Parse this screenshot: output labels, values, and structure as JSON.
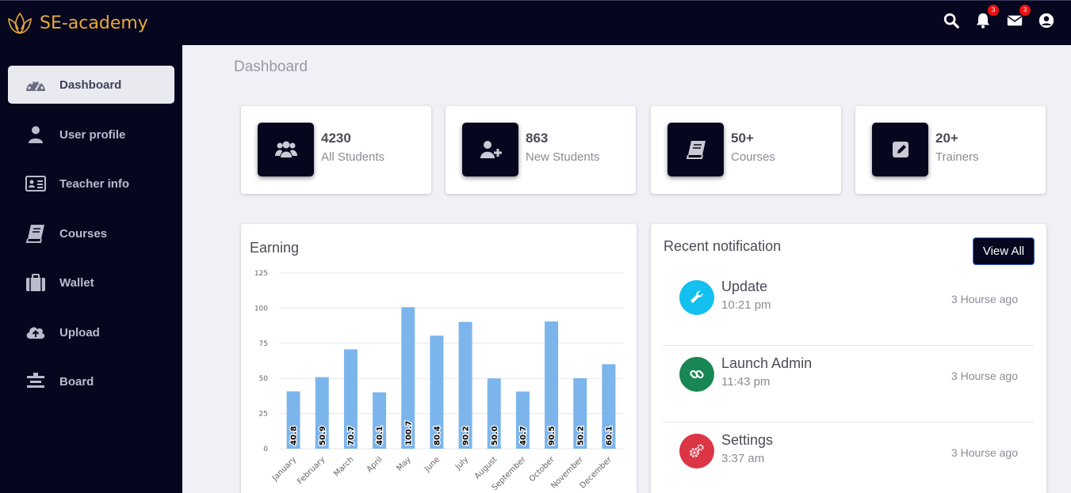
{
  "app": {
    "brand_name": "SE-academy",
    "brand_color": "#e6a93a",
    "notifications_badge": "3",
    "messages_badge": "3"
  },
  "sidebar": {
    "items": [
      {
        "label": "Dashboard",
        "icon": "dashboard-gauge-icon",
        "active": true
      },
      {
        "label": "User profile",
        "icon": "user-icon"
      },
      {
        "label": "Teacher info",
        "icon": "id-card-icon"
      },
      {
        "label": "Courses",
        "icon": "book-icon"
      },
      {
        "label": "Wallet",
        "icon": "briefcase-icon"
      },
      {
        "label": "Upload",
        "icon": "cloud-upload-icon"
      },
      {
        "label": "Board",
        "icon": "board-icon"
      }
    ]
  },
  "main": {
    "page_title": "Dashboard",
    "stats": [
      {
        "value": "4230",
        "label": "All Students",
        "icon": "users-icon"
      },
      {
        "value": "863",
        "label": "New Students",
        "icon": "user-plus-icon"
      },
      {
        "value": "50+",
        "label": "Courses",
        "icon": "book-icon"
      },
      {
        "value": "20+",
        "label": "Trainers",
        "icon": "edit-icon"
      }
    ],
    "earning": {
      "title": "Earning"
    },
    "notifications": {
      "title": "Recent notification",
      "view_all_label": "View All",
      "items": [
        {
          "title": "Update",
          "time": "10:21 pm",
          "ago": "3 Hourse ago",
          "icon": "wrench-icon",
          "color": "#13c0f0"
        },
        {
          "title": "Launch Admin",
          "time": "11:43 pm",
          "ago": "3 Hourse ago",
          "icon": "link-icon",
          "color": "#198754"
        },
        {
          "title": "Settings",
          "time": "3:37 am",
          "ago": "3 Hourse ago",
          "icon": "cogs-icon",
          "color": "#dc3545"
        }
      ]
    }
  },
  "chart_data": {
    "type": "bar",
    "title": "Earning",
    "categories": [
      "January",
      "February",
      "March",
      "April",
      "May",
      "June",
      "July",
      "August",
      "September",
      "October",
      "November",
      "December"
    ],
    "values": [
      40.8,
      50.9,
      70.7,
      40.1,
      100.7,
      80.4,
      90.2,
      50.0,
      40.7,
      90.5,
      50.2,
      60.1
    ],
    "value_labels": [
      "40.8",
      "50.9",
      "70.7",
      "40.1",
      "100.7",
      "80.4",
      "90.2",
      "50.0",
      "40.7",
      "90.5",
      "50.2",
      "60.1"
    ],
    "ylim": [
      0,
      125
    ],
    "yticks": [
      "0",
      "25",
      "50",
      "75",
      "100",
      "125"
    ],
    "grid": true,
    "bar_color": "#7cb5ec"
  }
}
